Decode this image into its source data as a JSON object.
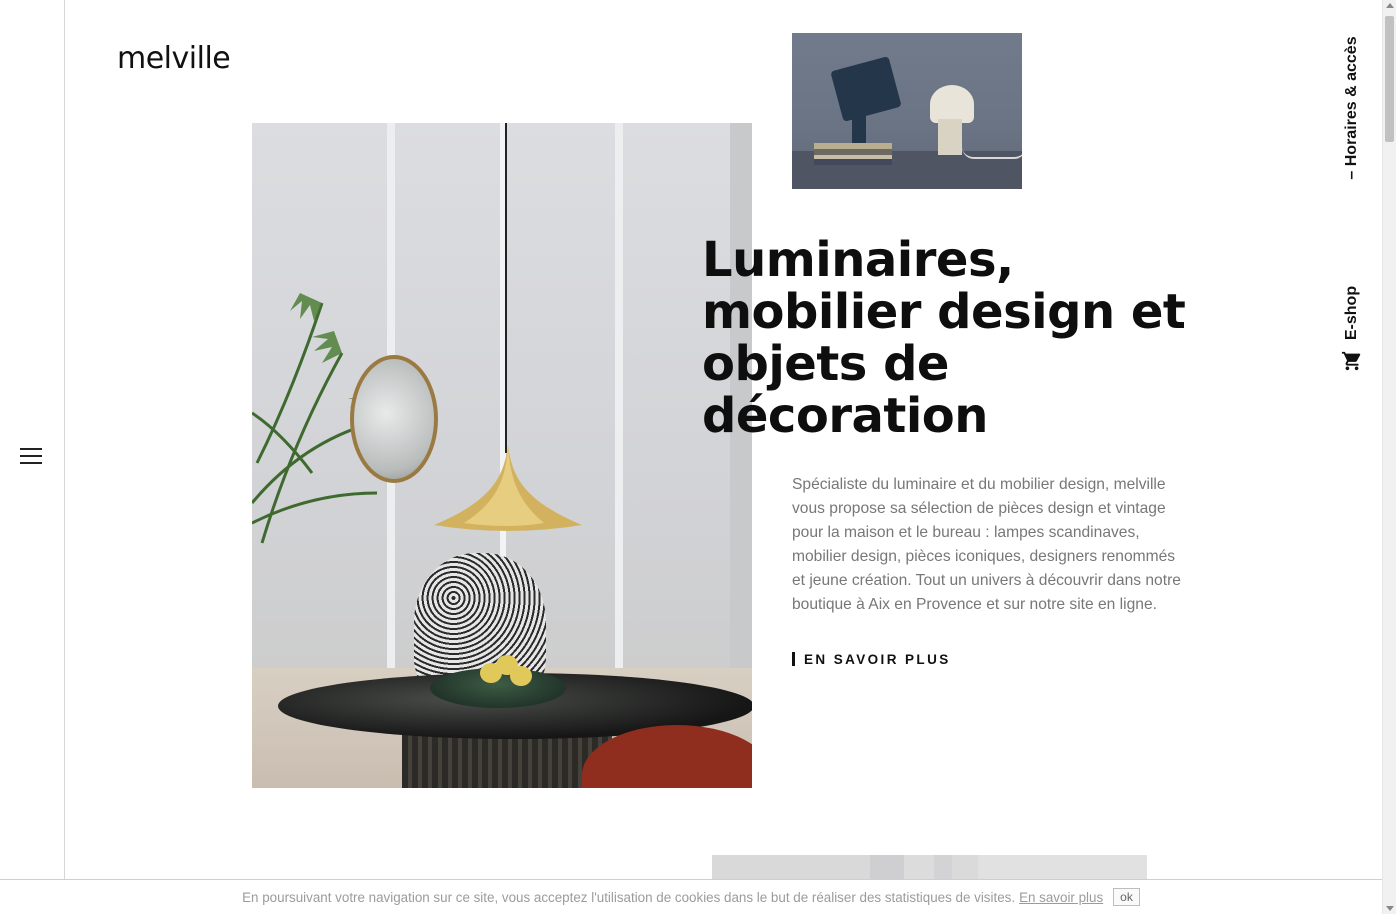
{
  "brand": {
    "logo_text": "melville"
  },
  "right_nav": {
    "hours_label": "– Horaires & accès",
    "shop_label": "E-shop"
  },
  "hero": {
    "headline": "Luminaires, mobilier design et objets de décoration",
    "description": "Spécialiste du luminaire et du mobilier design, melville vous propose sa sélection de pièces design et vintage pour la maison et le bureau : lampes scandinaves, mobilier design, pièces iconiques, designers renommés et jeune création. Tout un univers à découvrir dans notre boutique à Aix en Provence et sur notre site en ligne.",
    "cta_label": "EN SAVOIR PLUS"
  },
  "cookie": {
    "text": "En poursuivant votre navigation sur ce site, vous acceptez l'utilisation de cookies dans le but de réaliser des statistiques de visites.",
    "link_label": "En savoir plus",
    "ok_label": "ok"
  },
  "icons": {
    "menu": "hamburger-menu-icon",
    "cart": "shopping-cart-icon"
  },
  "colors": {
    "text": "#111111",
    "muted": "#777777",
    "cookie_text": "#9b9b9b"
  }
}
